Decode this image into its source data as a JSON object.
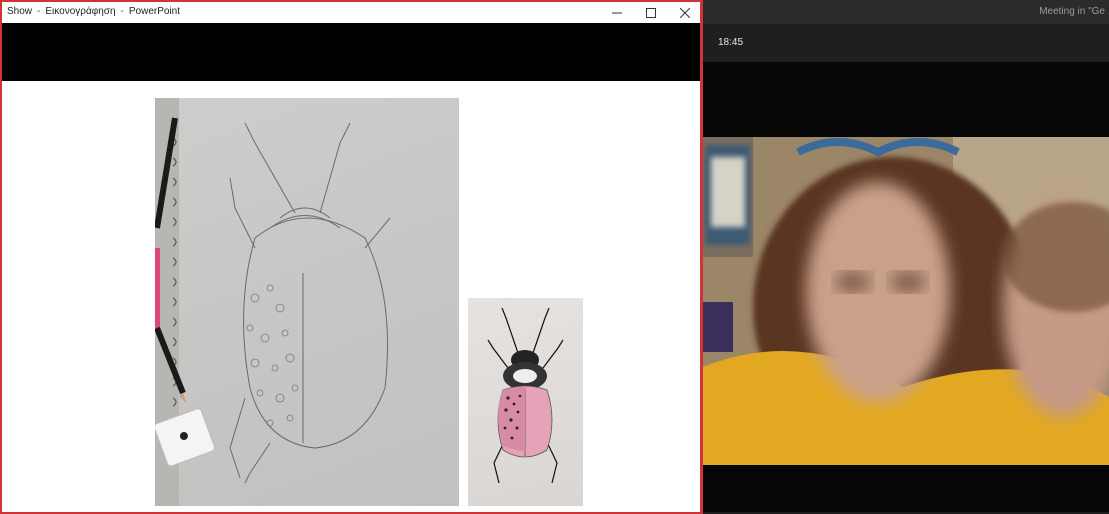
{
  "powerpoint": {
    "title_segments": [
      "Show",
      "Εικονογράφηση",
      "PowerPoint"
    ],
    "title_separator": "-",
    "window_controls": {
      "minimize_icon": "minimize-icon",
      "maximize_icon": "maximize-icon",
      "close_icon": "close-icon"
    },
    "slide": {
      "images": [
        "pencil-sketch-beetle-photo",
        "colored-pink-beetle-photo"
      ]
    },
    "border_color": "#d13438"
  },
  "teams": {
    "meeting_title": "Meeting in \"Ge",
    "call_timer": "18:45",
    "video": "participant-video-blurred"
  }
}
